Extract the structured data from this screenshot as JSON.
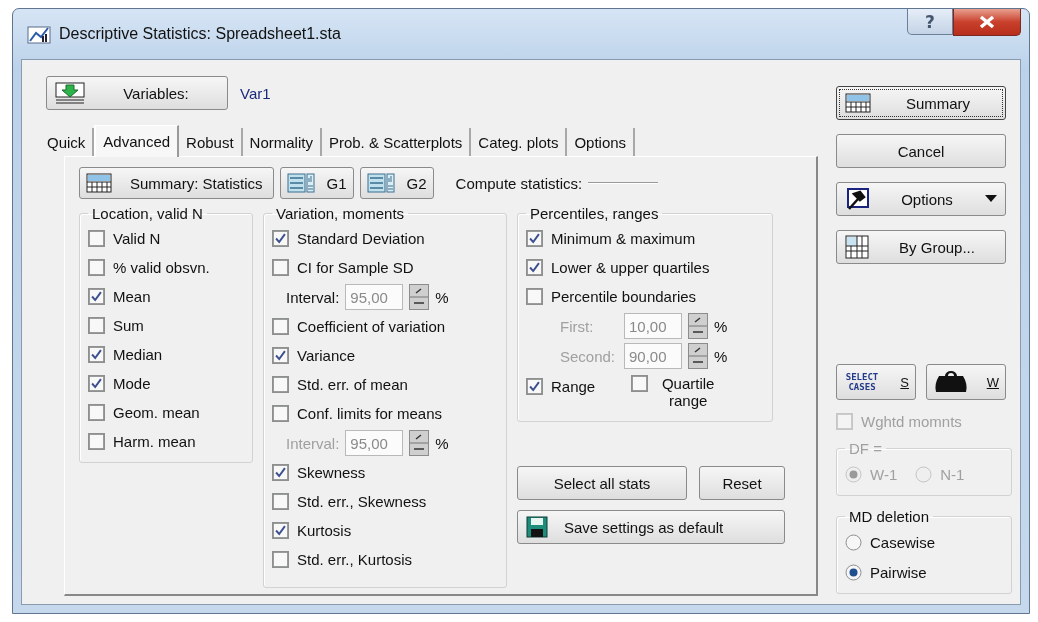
{
  "window": {
    "title": "Descriptive Statistics: Spreadsheet1.sta",
    "help_button": "?"
  },
  "variables": {
    "button_label": "Variables:",
    "value": "Var1"
  },
  "tabs": [
    {
      "label": "Quick",
      "selected": false
    },
    {
      "label": "Advanced",
      "selected": true
    },
    {
      "label": "Robust",
      "selected": false
    },
    {
      "label": "Normality",
      "selected": false
    },
    {
      "label": "Prob. & Scatterplots",
      "selected": false
    },
    {
      "label": "Categ. plots",
      "selected": false
    },
    {
      "label": "Options",
      "selected": false
    }
  ],
  "toolbar": {
    "summary_button": "Summary: Statistics",
    "graph_buttons": [
      "G1",
      "G2"
    ],
    "compute_label": "Compute statistics:"
  },
  "groups": [
    {
      "title": "Location, valid N",
      "items": [
        {
          "kind": "checkbox",
          "label": "Valid N",
          "checked": false
        },
        {
          "kind": "checkbox",
          "label": "% valid obsvn.",
          "checked": false
        },
        {
          "kind": "checkbox",
          "label": "Mean",
          "checked": true
        },
        {
          "kind": "checkbox",
          "label": "Sum",
          "checked": false
        },
        {
          "kind": "checkbox",
          "label": "Median",
          "checked": true
        },
        {
          "kind": "checkbox",
          "label": "Mode",
          "checked": true
        },
        {
          "kind": "checkbox",
          "label": "Geom. mean",
          "checked": false
        },
        {
          "kind": "checkbox",
          "label": "Harm. mean",
          "checked": false
        }
      ]
    },
    {
      "title": "Variation, moments",
      "items": [
        {
          "kind": "checkbox",
          "label": "Standard Deviation",
          "checked": true
        },
        {
          "kind": "checkbox",
          "label": "CI for Sample SD",
          "checked": false
        },
        {
          "kind": "spinner",
          "label": "Interval:",
          "value": "95,00",
          "unit": "%",
          "disabled": false
        },
        {
          "kind": "checkbox",
          "label": "Coefficient of variation",
          "checked": false
        },
        {
          "kind": "checkbox",
          "label": "Variance",
          "checked": true
        },
        {
          "kind": "checkbox",
          "label": "Std. err. of mean",
          "checked": false
        },
        {
          "kind": "checkbox",
          "label": "Conf. limits for means",
          "checked": false
        },
        {
          "kind": "spinner",
          "label": "Interval:",
          "value": "95,00",
          "unit": "%",
          "disabled": true
        },
        {
          "kind": "checkbox",
          "label": "Skewness",
          "checked": true
        },
        {
          "kind": "checkbox",
          "label": "Std. err., Skewness",
          "checked": false
        },
        {
          "kind": "checkbox",
          "label": "Kurtosis",
          "checked": true
        },
        {
          "kind": "checkbox",
          "label": "Std. err., Kurtosis",
          "checked": false
        }
      ]
    },
    {
      "title": "Percentiles, ranges",
      "items": [
        {
          "kind": "checkbox",
          "label": "Minimum & maximum",
          "checked": true
        },
        {
          "kind": "checkbox",
          "label": "Lower & upper quartiles",
          "checked": true
        },
        {
          "kind": "checkbox",
          "label": "Percentile boundaries",
          "checked": false
        },
        {
          "kind": "spinner",
          "label": "First:",
          "value": "10,00",
          "unit": "%",
          "disabled": true
        },
        {
          "kind": "spinner",
          "label": "Second:",
          "value": "90,00",
          "unit": "%",
          "disabled": true
        },
        {
          "kind": "pair",
          "items": [
            {
              "label": "Range",
              "checked": true
            },
            {
              "label": "Quartile range",
              "checked": false
            }
          ]
        }
      ]
    }
  ],
  "action_buttons": [
    "Select all stats",
    "Reset"
  ],
  "save_button": "Save settings as default",
  "side_buttons": [
    {
      "kind": "summary",
      "label": "Summary",
      "default": true
    },
    {
      "kind": "plain",
      "label": "Cancel",
      "default": false
    },
    {
      "kind": "options",
      "label": "Options",
      "default": false
    },
    {
      "kind": "by_group",
      "label": "By Group...",
      "default": false
    }
  ],
  "case_buttons": {
    "select_cases_icon": "SELECT CASES",
    "select_label": "S",
    "weight_label": "W"
  },
  "weighted": {
    "label": "Wghtd momnts",
    "checked": false,
    "disabled": true
  },
  "df": {
    "title": "DF =",
    "disabled": true,
    "options": [
      {
        "label": "W-1",
        "selected": true
      },
      {
        "label": "N-1",
        "selected": false
      }
    ]
  },
  "md_deletion": {
    "title": "MD deletion",
    "options": [
      {
        "label": "Casewise",
        "selected": false
      },
      {
        "label": "Pairwise",
        "selected": true
      }
    ]
  }
}
